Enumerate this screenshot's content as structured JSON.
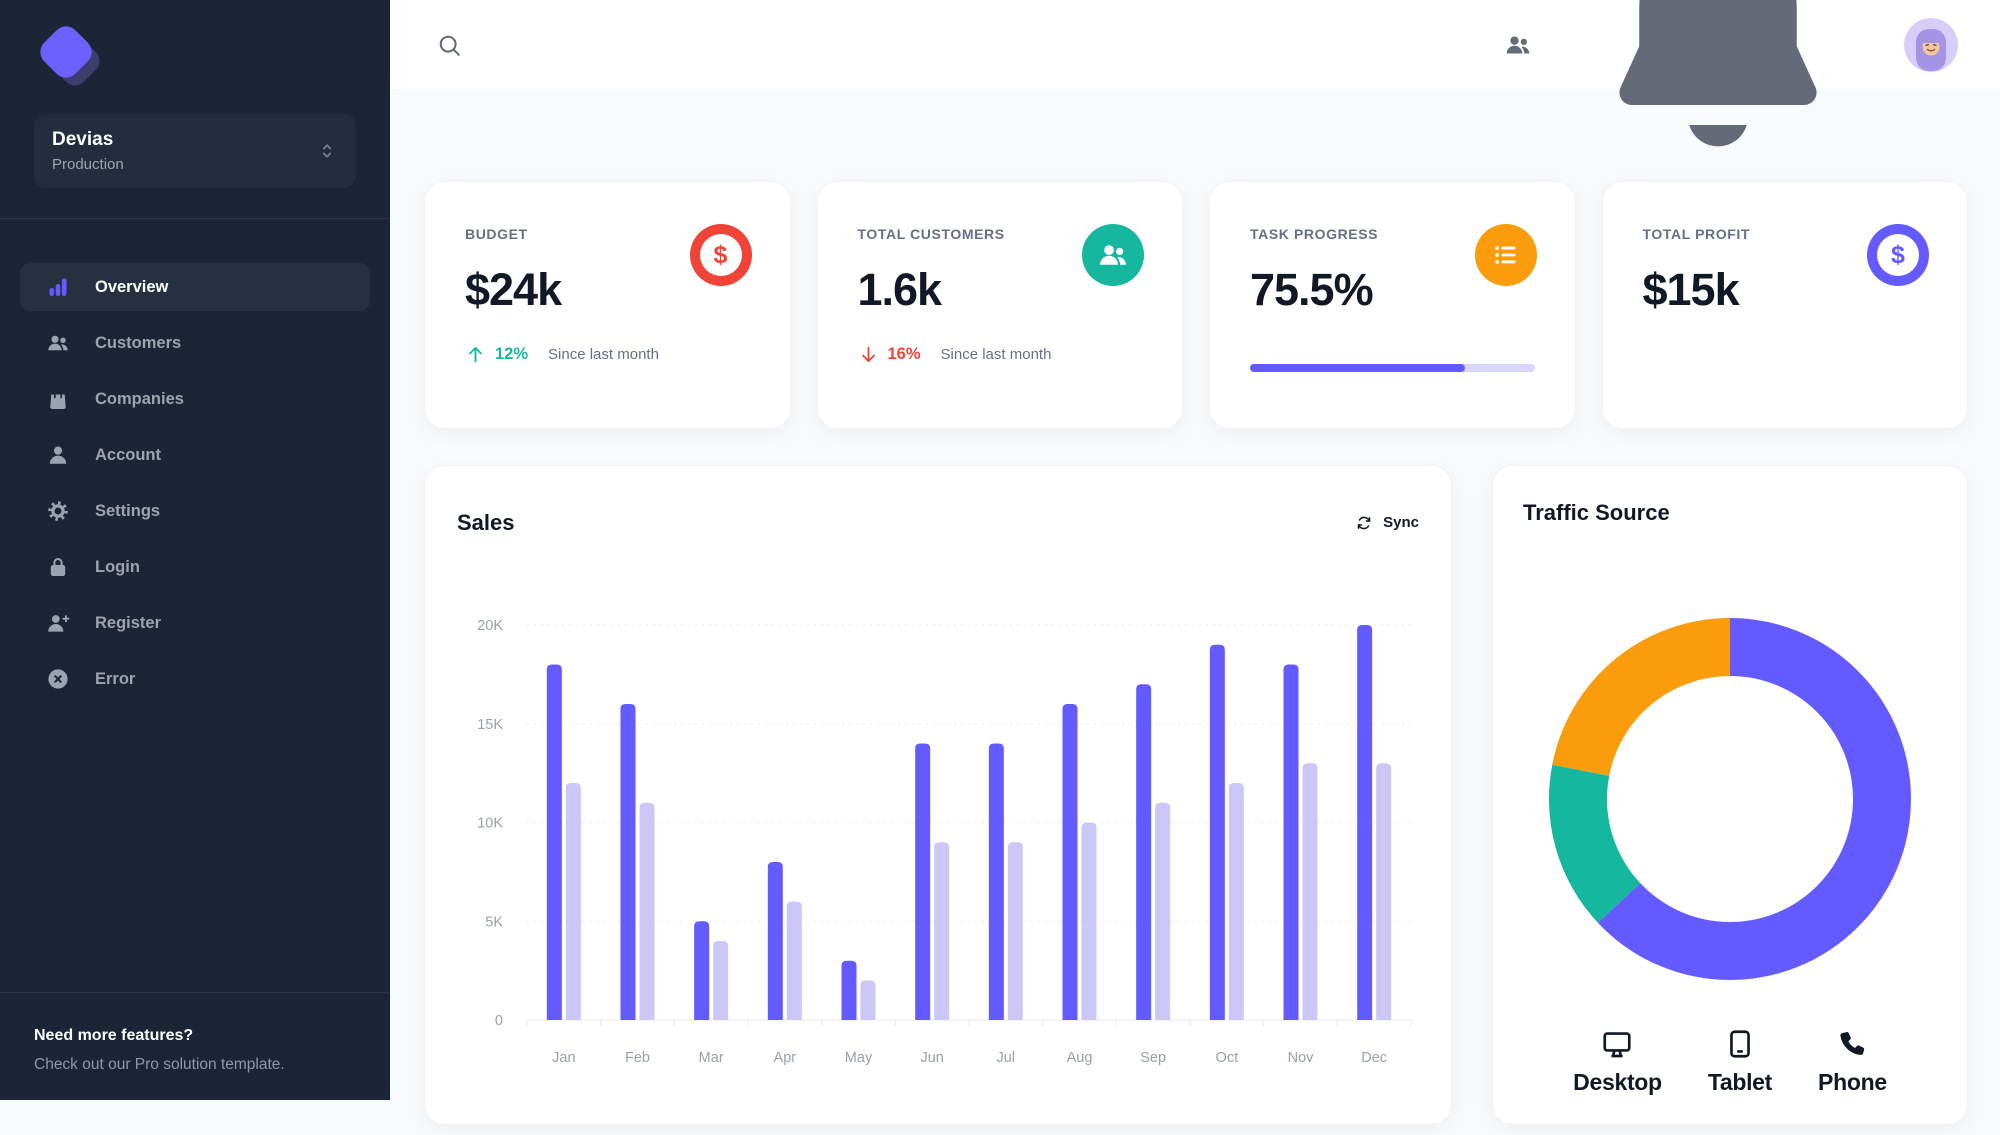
{
  "sidebar": {
    "workspace": {
      "name": "Devias",
      "environment": "Production"
    },
    "nav": [
      {
        "label": "Overview",
        "icon": "chart-bar-icon",
        "active": true
      },
      {
        "label": "Customers",
        "icon": "users-icon",
        "active": false
      },
      {
        "label": "Companies",
        "icon": "shopping-bag-icon",
        "active": false
      },
      {
        "label": "Account",
        "icon": "user-icon",
        "active": false
      },
      {
        "label": "Settings",
        "icon": "gear-icon",
        "active": false
      },
      {
        "label": "Login",
        "icon": "lock-icon",
        "active": false
      },
      {
        "label": "Register",
        "icon": "user-plus-icon",
        "active": false
      },
      {
        "label": "Error",
        "icon": "x-circle-icon",
        "active": false
      }
    ],
    "footer": {
      "title": "Need more features?",
      "subtitle": "Check out our Pro solution template."
    }
  },
  "topbar": {
    "notification_dot_color": "#15b79e"
  },
  "stats": [
    {
      "label": "BUDGET",
      "value": "$24k",
      "icon": "dollar-icon",
      "icon_bg": "#f04438",
      "trend": {
        "icon": "arrow-up-icon",
        "value": "12%",
        "color": "#15b79e",
        "caption": "Since last month"
      }
    },
    {
      "label": "TOTAL CUSTOMERS",
      "value": "1.6k",
      "icon": "users-icon",
      "icon_bg": "#15b79e",
      "trend": {
        "icon": "arrow-down-icon",
        "value": "16%",
        "color": "#f04438",
        "caption": "Since last month"
      }
    },
    {
      "label": "TASK PROGRESS",
      "value": "75.5%",
      "icon": "list-bullet-icon",
      "icon_bg": "#fb9c0c",
      "progress_percent": 75.5,
      "progress_color": "#635bff",
      "progress_track": "#d9d6fe"
    },
    {
      "label": "TOTAL PROFIT",
      "value": "$15k",
      "icon": "dollar-icon",
      "icon_bg": "#635bff"
    }
  ],
  "sales_card": {
    "title": "Sales",
    "sync_label": "Sync",
    "chart_data": {
      "type": "bar",
      "categories": [
        "Jan",
        "Feb",
        "Mar",
        "Apr",
        "May",
        "Jun",
        "Jul",
        "Aug",
        "Sep",
        "Oct",
        "Nov",
        "Dec"
      ],
      "series": [
        {
          "name": "primary",
          "color": "#635bff",
          "values": [
            18,
            16,
            5,
            8,
            3,
            14,
            14,
            16,
            17,
            19,
            18,
            20
          ]
        },
        {
          "name": "secondary",
          "color": "#cbc7f7",
          "values": [
            12,
            11,
            4,
            6,
            2,
            9,
            9,
            10,
            11,
            12,
            13,
            13
          ]
        }
      ],
      "y_ticks": [
        {
          "label": "20K",
          "value": 20
        },
        {
          "label": "15K",
          "value": 15
        },
        {
          "label": "10K",
          "value": 10
        },
        {
          "label": "5K",
          "value": 5
        },
        {
          "label": "0",
          "value": 0
        }
      ],
      "ylim": [
        0,
        20
      ],
      "unit": "K",
      "grid": "dotted-horizontal",
      "legend_position": "none"
    }
  },
  "traffic_card": {
    "title": "Traffic Source",
    "chart_data": {
      "type": "donut",
      "labels": [
        "Desktop",
        "Tablet",
        "Phone"
      ],
      "values": [
        63,
        15,
        22
      ],
      "colors": [
        "#635bff",
        "#15b79e",
        "#fb9c0c"
      ],
      "legend_position": "bottom"
    },
    "legend": [
      {
        "label": "Desktop",
        "icon": "desktop-icon"
      },
      {
        "label": "Tablet",
        "icon": "tablet-icon"
      },
      {
        "label": "Phone",
        "icon": "phone-icon"
      }
    ]
  }
}
